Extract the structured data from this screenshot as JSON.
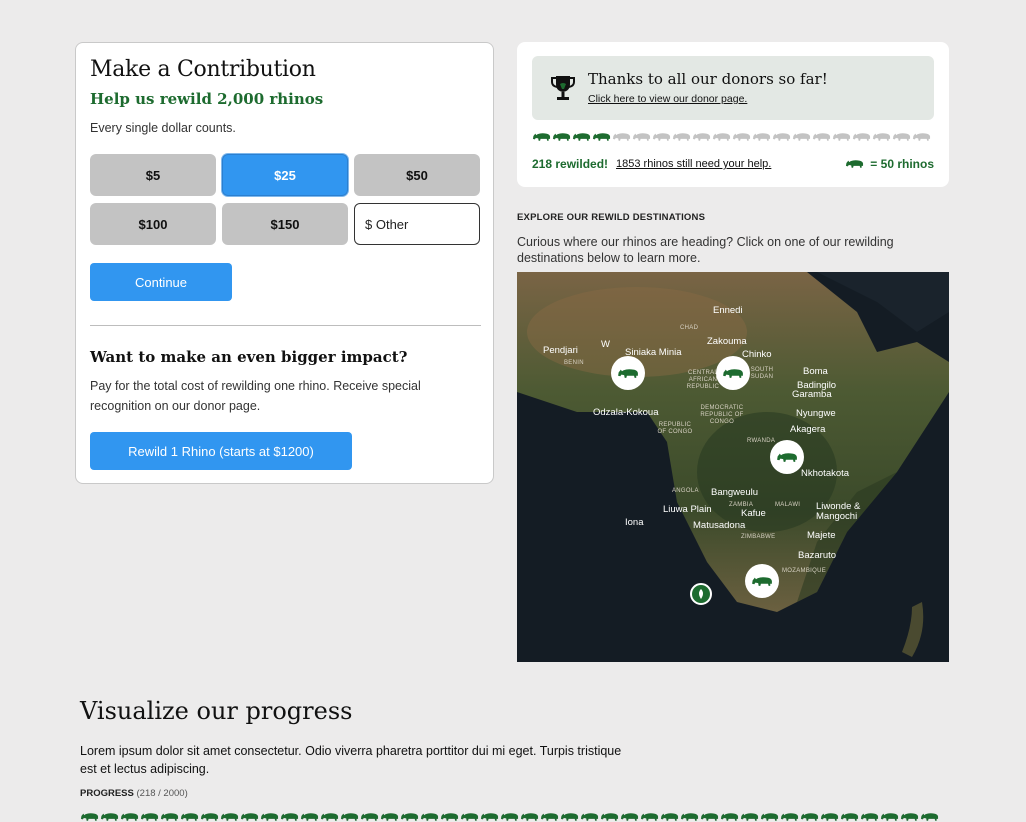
{
  "contribution": {
    "title": "Make a Contribution",
    "subtitle": "Help us rewild 2,000 rhinos",
    "note": "Every single dollar counts.",
    "amounts": [
      "$5",
      "$25",
      "$50",
      "$100",
      "$150"
    ],
    "selected_amount": "$25",
    "other_placeholder": "$ Other",
    "continue_label": "Continue",
    "impact_title": "Want to make an even bigger impact?",
    "impact_text": "Pay for the total cost of rewilding one rhino. Receive special recognition on our donor page.",
    "rewild_label": "Rewild 1 Rhino (starts at $1200)"
  },
  "donors": {
    "title": "Thanks to all our donors so far!",
    "link": "Click here to view our donor page.",
    "rewilded_text": "218 rewilded!",
    "need_text": "1853 rhinos still need your help.",
    "legend_text": "= 50 rhinos",
    "icons_filled": 4,
    "icons_total": 20
  },
  "explore": {
    "heading": "EXPLORE OUR REWILD DESTINATIONS",
    "text": "Curious where our rhinos are heading? Click on one of our rewilding destinations below to learn more."
  },
  "map": {
    "places": [
      "Ennedi",
      "Zakouma",
      "Pendjari",
      "W",
      "Siniaka Minia",
      "Chinko",
      "Boma",
      "Badingilo",
      "Garamba",
      "Odzala-Kokoua",
      "Nyungwe",
      "Akagera",
      "Nkhotakota",
      "Bangweulu",
      "Liuwa Plain",
      "Kafue",
      "Liwonde &",
      "Mangochi",
      "Iona",
      "Matusadona",
      "Majete",
      "Bazaruto"
    ],
    "countries": [
      "CHAD",
      "BENIN",
      "CENTRAL AFRICAN REPUBLIC",
      "SOUTH SUDAN",
      "DEMOCRATIC REPUBLIC OF CONGO",
      "REPUBLIC OF CONGO",
      "RWANDA",
      "ANGOLA",
      "ZAMBIA",
      "MALAWI",
      "ZIMBABWE",
      "MOZAMBIQUE"
    ]
  },
  "progress": {
    "title": "Visualize our progress",
    "text": "Lorem ipsum dolor sit amet consectetur. Odio viverra pharetra porttitor dui mi eget. Turpis tristique est et lectus adipiscing.",
    "label": "PROGRESS",
    "count": "(218 / 2000)"
  },
  "colors": {
    "accent": "#3196f0",
    "green": "#1d6b2f",
    "grey": "#c3c3c3"
  }
}
